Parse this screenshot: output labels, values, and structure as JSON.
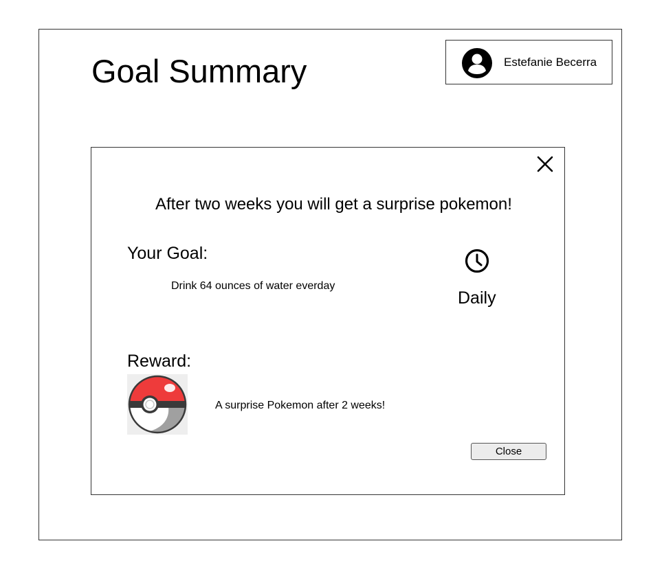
{
  "page": {
    "title": "Goal Summary"
  },
  "user": {
    "name": "Estefanie Becerra",
    "avatar_icon": "account-circle-icon"
  },
  "dialog": {
    "close_icon": "close-icon",
    "headline": "After two weeks you will get a surprise pokemon!",
    "goal_heading": "Your Goal:",
    "goal_text": "Drink 64 ounces of water everday",
    "frequency_icon": "clock-icon",
    "frequency": "Daily",
    "reward_heading": "Reward:",
    "reward_image": "pokeball-image",
    "reward_text": "A surprise Pokemon after 2 weeks!",
    "close_button_label": "Close"
  },
  "colors": {
    "pokeball_red": "#ee3b3b",
    "pokeball_white": "#ffffff",
    "pokeball_band": "#3a3a3a",
    "pokeball_shadow": "#a0a0a0"
  }
}
